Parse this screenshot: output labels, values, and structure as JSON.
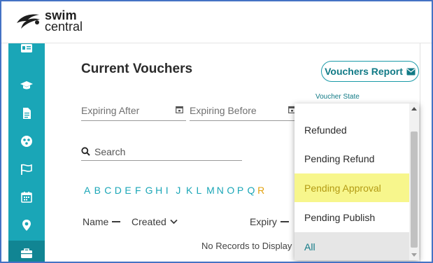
{
  "brand": {
    "line1": "swim",
    "line2": "central"
  },
  "sidebar": {
    "items": [
      {
        "icon": "id-card-icon"
      },
      {
        "icon": "graduation-cap-icon"
      },
      {
        "icon": "document-icon"
      },
      {
        "icon": "group-icon"
      },
      {
        "icon": "flag-icon"
      },
      {
        "icon": "calendar-icon"
      },
      {
        "icon": "location-pin-icon"
      },
      {
        "icon": "briefcase-icon",
        "active": true
      }
    ],
    "accent": "#1aa6b7"
  },
  "page": {
    "title": "Current Vouchers",
    "report_button": "Vouchers Report"
  },
  "filters": {
    "expiring_after": "Expiring After",
    "expiring_before": "Expiring Before",
    "voucher_state_label": "Voucher State",
    "search_placeholder": "Search"
  },
  "alphabet": [
    "A",
    "B",
    "C",
    "D",
    "E",
    "F",
    "G",
    "H",
    "I",
    "J",
    "K",
    "L",
    "M",
    "N",
    "O",
    "P",
    "Q",
    "R"
  ],
  "table": {
    "columns": {
      "name": "Name",
      "created": "Created",
      "expiry": "Expiry"
    },
    "empty_message": "No Records to Display"
  },
  "dropdown": {
    "options": [
      {
        "label": "Refunded"
      },
      {
        "label": "Pending Refund"
      },
      {
        "label": "Pending Approval",
        "highlighted": true
      },
      {
        "label": "Pending Publish"
      },
      {
        "label": "All",
        "selected": true
      }
    ],
    "highlight_color": "#f7f68c"
  }
}
